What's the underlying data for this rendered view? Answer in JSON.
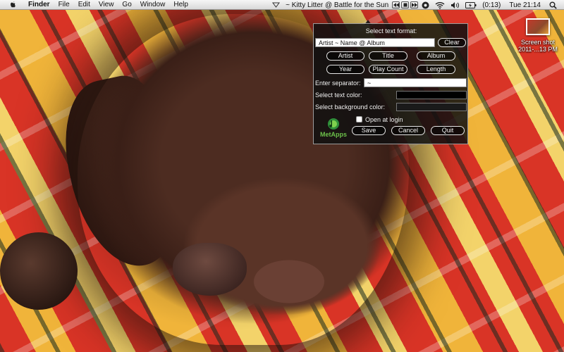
{
  "menubar": {
    "app_menus": [
      "Finder",
      "File",
      "Edit",
      "View",
      "Go",
      "Window",
      "Help"
    ],
    "now_playing": "~ Kitty Litter @ Battle for the Sun",
    "battery": "(0:13)",
    "clock": "Tue 21:14",
    "icons": [
      "apple-icon",
      "now-playing-arrow-icon",
      "previous-track-icon",
      "stop-icon",
      "next-track-icon",
      "metapps-menu-icon",
      "airport-wifi-icon",
      "volume-icon",
      "battery-icon",
      "spotlight-icon"
    ]
  },
  "desktop_icon": {
    "label_line1": "Screen shot",
    "label_line2": "2011-...13 PM"
  },
  "panel": {
    "title": "Select text format:",
    "format_value": "Artist ~ Name @ Album",
    "clear_label": "Clear",
    "tokens_row1": [
      "Artist",
      "Title",
      "Album"
    ],
    "tokens_row2": [
      "Year",
      "Play Count",
      "Length"
    ],
    "separator_label": "Enter separator:",
    "separator_value": "~",
    "text_color_label": "Select text color:",
    "bg_color_label": "Select background color:",
    "text_color": "#000000",
    "bg_color": "#1a1a1a",
    "open_at_login_label": "Open at login",
    "open_at_login_checked": false,
    "logo_text": "MetApps",
    "save_label": "Save",
    "cancel_label": "Cancel",
    "quit_label": "Quit"
  },
  "colors": {
    "panel_bg": "#101010",
    "logo_green": "#6cc04a",
    "logo_blue": "#1f6fd1"
  }
}
